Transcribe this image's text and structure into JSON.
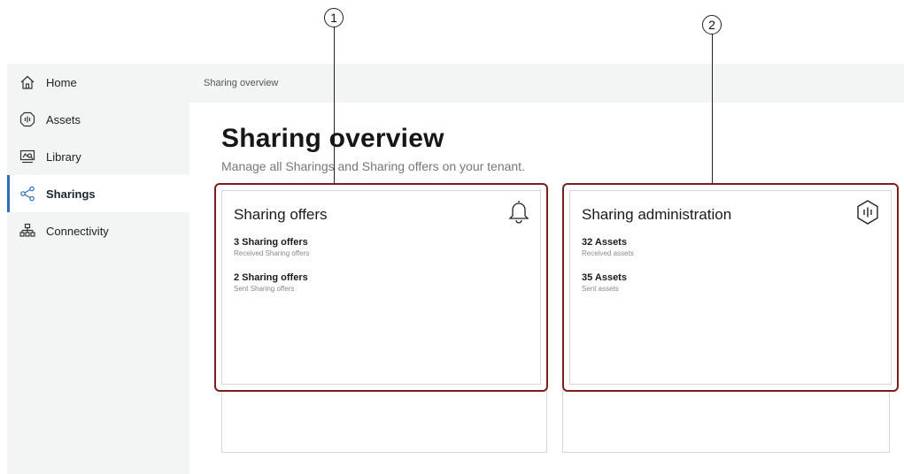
{
  "callouts": [
    "1",
    "2"
  ],
  "sidebar": {
    "items": [
      {
        "label": "Home",
        "icon": "home-icon"
      },
      {
        "label": "Assets",
        "icon": "asset-icon"
      },
      {
        "label": "Library",
        "icon": "library-icon"
      },
      {
        "label": "Sharings",
        "icon": "share-icon",
        "active": true
      },
      {
        "label": "Connectivity",
        "icon": "network-icon"
      }
    ]
  },
  "breadcrumb": "Sharing overview",
  "page": {
    "title": "Sharing overview",
    "subtitle": "Manage all Sharings and Sharing offers on your tenant."
  },
  "cards": [
    {
      "title": "Sharing offers",
      "icon": "bell-icon",
      "stats": [
        {
          "value": "3 Sharing offers",
          "label": "Received Sharing offers"
        },
        {
          "value": "2 Sharing offers",
          "label": "Sent Sharing offers"
        }
      ]
    },
    {
      "title": "Sharing administration",
      "icon": "asset-icon",
      "stats": [
        {
          "value": "32 Assets",
          "label": "Received assets"
        },
        {
          "value": "35 Assets",
          "label": "Sent assets"
        }
      ]
    }
  ],
  "colors": {
    "highlight_border": "#7a1e1e",
    "active_accent": "#2f6fb5",
    "sidebar_bg": "#f3f4f4"
  }
}
